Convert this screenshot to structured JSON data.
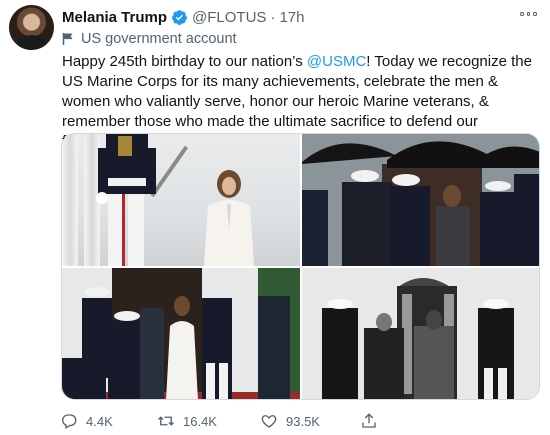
{
  "tweet": {
    "display_name": "Melania Trump",
    "handle": "@FLOTUS",
    "separator": "·",
    "time": "17h",
    "label": "US government account",
    "text_before": "Happy 245th birthday to our nation’s ",
    "mention": "@USMC",
    "text_after": "! Today we recognize the US Marine Corps for its many achievements, celebrate the men & women who valiantly serve, honor our heroic Marine veterans, & remember those who made the ultimate sacrifice to defend our freedoms."
  },
  "icons": {
    "avatar": "profile-photo",
    "verified": "verified-badge-icon",
    "more": "more-options-icon",
    "flag": "flag-icon",
    "reply": "reply-icon",
    "retweet": "retweet-icon",
    "like": "heart-icon",
    "share": "share-icon"
  },
  "media": {
    "photos": [
      "photo-1",
      "photo-2",
      "photo-3",
      "photo-4"
    ]
  },
  "actions": {
    "reply_count": "4.4K",
    "retweet_count": "16.4K",
    "like_count": "93.5K"
  },
  "colors": {
    "link": "#1d9bf0",
    "secondary_text": "#536471",
    "verified": "#1d9bf0"
  }
}
